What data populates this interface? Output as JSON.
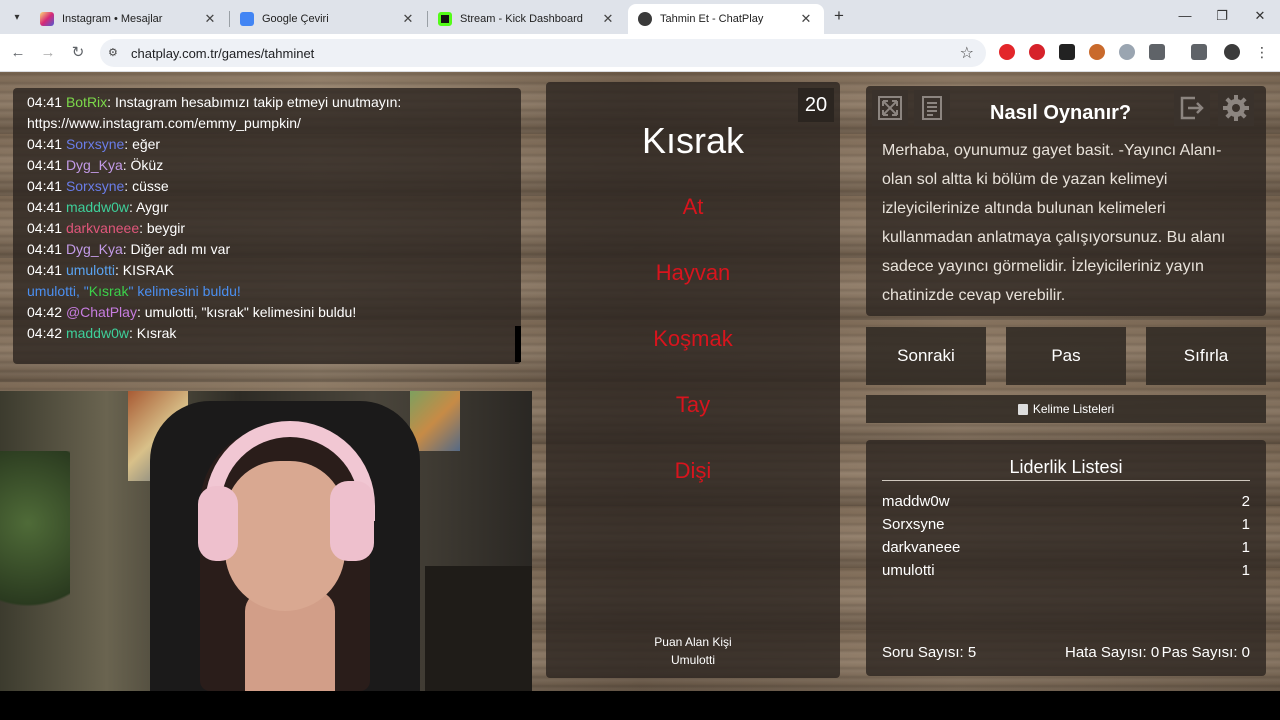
{
  "browser": {
    "tabs": [
      {
        "title": "Instagram • Mesajlar",
        "color": "#d62976"
      },
      {
        "title": "Google Çeviri",
        "color": "#4285f4"
      },
      {
        "title": "Stream - Kick Dashboard",
        "color": "#53fc18"
      },
      {
        "title": "Tahmin Et - ChatPlay",
        "color": "#3a3a3a"
      }
    ],
    "close_glyph": "✕",
    "new_tab_glyph": "+",
    "url": "chatplay.com.tr/games/tahminet"
  },
  "chat": {
    "lines": [
      {
        "time": "04:41",
        "user": "BotRix",
        "color": "#7cd94a",
        "text": ": Instagram hesabımızı takip etmeyi unutmayın: https://www.instagram.com/emmy_pumpkin/"
      },
      {
        "time": "04:41",
        "user": "Sorxsyne",
        "color": "#6a7de8",
        "text": ": eğer"
      },
      {
        "time": "04:41",
        "user": "Dyg_Kya",
        "color": "#c39be8",
        "text": ": Öküz"
      },
      {
        "time": "04:41",
        "user": "Sorxsyne",
        "color": "#6a7de8",
        "text": ": cüsse"
      },
      {
        "time": "04:41",
        "user": "maddw0w",
        "color": "#3ecf9a",
        "text": ": Aygır"
      },
      {
        "time": "04:41",
        "user": "darkvaneee",
        "color": "#e0567b",
        "text": ": beygir"
      },
      {
        "time": "04:41",
        "user": "Dyg_Kya",
        "color": "#c39be8",
        "text": ": Diğer adı mı var"
      },
      {
        "time": "04:41",
        "user": "umulotti",
        "color": "#5aa3f0",
        "text": ": KISRAK"
      }
    ],
    "found_notice": {
      "user": "umulotti",
      "pre": ", \"",
      "word": "Kısrak",
      "post": "\" kelimesini buldu!"
    },
    "bot_line": {
      "time": "04:42",
      "user": "@ChatPlay",
      "color": "#c77de0",
      "text": ": umulotti, \"kısrak\" kelimesini buldu!"
    },
    "last_line": {
      "time": "04:42",
      "user": "maddw0w",
      "color": "#3ecf9a",
      "text": ": Kısrak"
    }
  },
  "game": {
    "timer": "20",
    "main_word": "Kısrak",
    "taboo_words": [
      "At",
      "Hayvan",
      "Koşmak",
      "Tay",
      "Dişi"
    ],
    "scorer_label": "Puan Alan Kişi",
    "scorer_name": "Umulotti"
  },
  "howto": {
    "title": "Nasıl Oynanır?",
    "body": "Merhaba, oyunumuz gayet basit. -Yayıncı Alanı- olan sol altta ki bölüm de yazan kelimeyi izleyicilerinize altında bulunan kelimeleri kullanmadan anlatmaya çalışıyorsunuz. Bu alanı sadece yayıncı görmelidir. İzleyicileriniz yayın chatinizde cevap verebilir."
  },
  "buttons": {
    "next": "Sonraki",
    "pass": "Pas",
    "reset": "Sıfırla",
    "word_lists": "Kelime Listeleri"
  },
  "leaderboard": {
    "title": "Liderlik Listesi",
    "rows": [
      {
        "name": "maddw0w",
        "score": "2"
      },
      {
        "name": "Sorxsyne",
        "score": "1"
      },
      {
        "name": "darkvaneee",
        "score": "1"
      },
      {
        "name": "umulotti",
        "score": "1"
      }
    ],
    "question_count": "Soru Sayısı: 5",
    "error_count": "Hata Sayısı: 0",
    "pass_count": "Pas Sayısı: 0"
  },
  "icons": [
    "fullscreen-icon",
    "document-icon",
    "logout-icon",
    "settings-gear-icon"
  ]
}
